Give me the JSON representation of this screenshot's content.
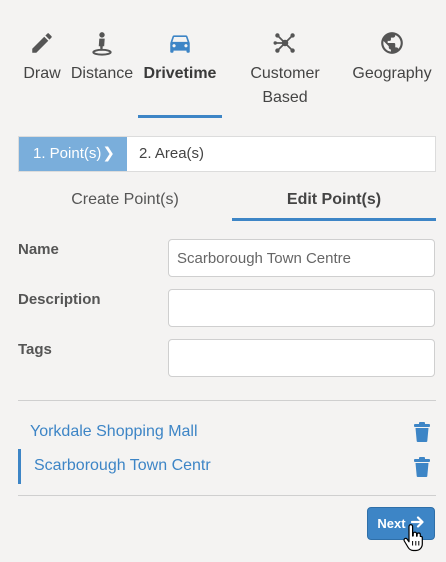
{
  "tool_tabs": [
    {
      "label": "Draw",
      "icon": "pencil-icon"
    },
    {
      "label": "Distance",
      "icon": "person-pin-icon"
    },
    {
      "label": "Drivetime",
      "icon": "car-icon",
      "active": true
    },
    {
      "label": "Customer Based",
      "line1": "Customer",
      "line2": "Based",
      "icon": "network-icon"
    },
    {
      "label": "Geography",
      "icon": "globe-icon"
    }
  ],
  "steps": {
    "step1": "1. Point(s)",
    "step2": "2. Area(s)"
  },
  "sub_tabs": {
    "create": "Create Point(s)",
    "edit": "Edit Point(s)"
  },
  "form": {
    "name_label": "Name",
    "name_value": "Scarborough Town Centre",
    "description_label": "Description",
    "description_value": "",
    "tags_label": "Tags",
    "tags_value": ""
  },
  "points": [
    {
      "name": "Yorkdale Shopping Mall"
    },
    {
      "name": "Scarborough Town Centr"
    }
  ],
  "next_button": "Next",
  "colors": {
    "accent": "#3d85c6",
    "step_active": "#7aaedb",
    "background": "#f4f3f2"
  }
}
